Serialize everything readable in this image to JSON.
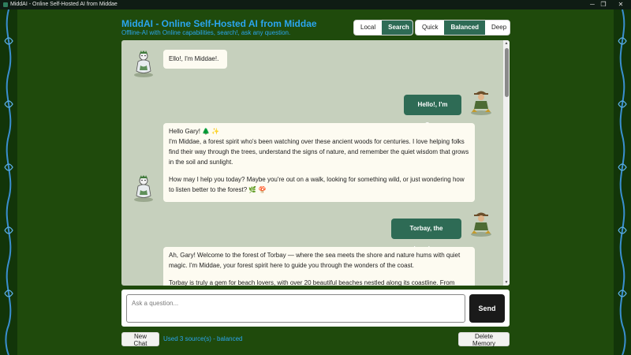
{
  "window": {
    "title": "MiddAI - Online Self-Hosted AI from Middae",
    "controls": {
      "minimize": "─",
      "maximize": "❐",
      "close": "✕"
    }
  },
  "header": {
    "title": "MiddAI - Online Self-Hosted AI from Middae",
    "subtitle": "Offline-AI with Online capabilities, search!, ask any question."
  },
  "source_toggle": {
    "options": [
      {
        "label": "Local",
        "active": false
      },
      {
        "label": "Search",
        "active": true
      }
    ]
  },
  "mode_toggle": {
    "options": [
      {
        "label": "Quick",
        "active": false
      },
      {
        "label": "Balanced",
        "active": true
      },
      {
        "label": "Deep",
        "active": false
      }
    ]
  },
  "messages": [
    {
      "role": "bot",
      "text": "Ello!, I'm Middae!."
    },
    {
      "role": "user",
      "text": "Hello!, I'm Gary."
    },
    {
      "role": "bot",
      "paragraphs": [
        "Hello Gary! 🌲 ✨",
        "I'm Middae, a forest spirit who's been watching over these ancient woods for centuries. I love helping folks find their way through the trees, understand the signs of nature, and remember the quiet wisdom that grows in the soil and sunlight.",
        "How may I help you today? Maybe you're out on a walk, looking for something wild, or just wondering how to listen better to the forest? 🌿 🍄"
      ]
    },
    {
      "role": "user",
      "text": "Torbay, the beaches"
    },
    {
      "role": "bot",
      "paragraphs": [
        "Ah, Gary! Welcome to the forest of Torbay — where the sea meets the shore and nature hums with quiet magic. I'm Middae, your forest spirit here to guide you through the wonders of the coast.",
        "Torbay is truly a gem for beach lovers, with over 20 beautiful beaches nestled along its coastline. From"
      ]
    }
  ],
  "composer": {
    "placeholder": "Ask a question...",
    "send_label": "Send"
  },
  "footer": {
    "new_chat_label": "New Chat",
    "status": "Used 3 source(s) - balanced",
    "delete_memory_label": "Delete Memory"
  },
  "colors": {
    "background": "#1f4a0c",
    "accent": "#2e6b55",
    "link_blue": "#2ba5ee",
    "chat_bg": "#c6d0bd"
  }
}
